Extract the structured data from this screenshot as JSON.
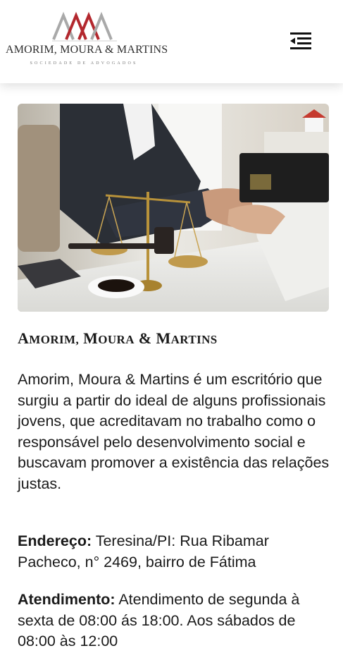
{
  "header": {
    "logo_name": "AMORIM, MOURA & MARTINS",
    "logo_tagline": "SOCIEDADE DE ADVOGADOS",
    "menu_icon": "menu-collapse-icon",
    "brand_red": "#b3282e",
    "brand_gray": "#9a9a9a"
  },
  "hero": {
    "image_subject": "handshake-with-scales-of-justice"
  },
  "content": {
    "title": "Amorim, Moura & Martins",
    "description": "Amorim, Moura & Martins é um escritório que surgiu a partir do ideal de alguns profissionais jovens, que acreditavam no trabalho como o responsável pelo desenvolvimento social e buscavam promover a existência das relações justas.",
    "address_label": "Endereço:",
    "address_text": " Teresina/PI: Rua Ribamar Pacheco, n° 2469, bairro de Fátima",
    "hours_label": "Atendimento:",
    "hours_text": " Atendimento de segunda à sexta de 08:00 ás 18:00. Aos sábados de 08:00 às 12:00"
  }
}
